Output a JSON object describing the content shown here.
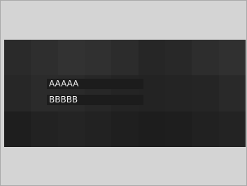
{
  "window": {
    "background": "#d4d4d4",
    "border": "#a9a9a9"
  },
  "banner": {
    "tiles": [
      "#2a2a2a",
      "#2e2e2e",
      "#323232",
      "#303030",
      "#2c2c2c",
      "#262626",
      "#282828",
      "#2d2d2d",
      "#303030",
      "#272727",
      "#2b2b2b",
      "#2a2a2a",
      "#272727",
      "#242424",
      "#232323",
      "#242424",
      "#252525",
      "#292929",
      "#1e1e1e",
      "#222222",
      "#242424",
      "#222222",
      "#1f1f1f",
      "#1d1d1d",
      "#1e1e1e",
      "#212121",
      "#232323"
    ]
  },
  "fields": [
    {
      "text": "AAAAA"
    },
    {
      "text": "BBBBB"
    }
  ]
}
